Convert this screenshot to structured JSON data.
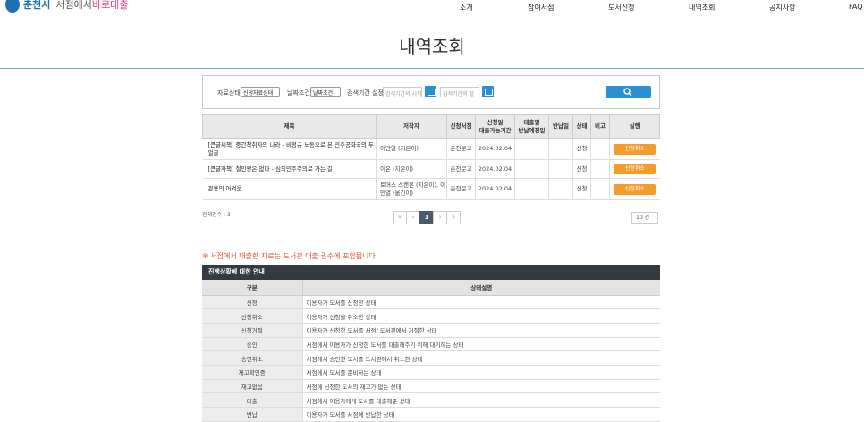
{
  "header": {
    "city": "춘천시",
    "service_prefix": "서점에서",
    "service_accent": "바로대출",
    "nav": [
      "소개",
      "참여서점",
      "도서신청",
      "내역조회",
      "공지사항",
      "FAQ"
    ]
  },
  "page_title": "내역조회",
  "search": {
    "material_status_label": "자료상태",
    "material_status_value": "신청자료상태",
    "date_condition_label": "날짜조건",
    "date_condition_value": "날짜조건",
    "period_label": "검색기간 설정",
    "start_placeholder": "검색기간의 시작",
    "end_placeholder": "검색기간의 끝"
  },
  "table": {
    "headers": [
      "제목",
      "저작자",
      "신청서점",
      "신청일\n대출가능기간",
      "대출일\n반납예정일",
      "반납일",
      "상태",
      "비고",
      "실행"
    ],
    "rows": [
      {
        "title": "[큰글씨책] 중간착취자의 나라 - 비정규 노동으로 본 민주공화국의 두 얼굴",
        "author": "이만열 (지은이)",
        "store": "춘천문고",
        "date": "2024.02.04",
        "status": "신청",
        "action": "신청취소"
      },
      {
        "title": "[큰글자책] 철인왕은 없다 - 심의민주주의로 가는 길",
        "author": "이은 (지은이)",
        "store": "춘천문고",
        "date": "2024.02.04",
        "status": "신청",
        "action": "신청취소"
      },
      {
        "title": "관용의 어려움",
        "author": "토머스 스캔론 (지은이), 이민열 (옮긴이)",
        "store": "춘천문고",
        "date": "2024.02.04",
        "status": "신청",
        "action": "신청취소"
      }
    ]
  },
  "total": "전체건수 : 3",
  "pager": {
    "first": "«",
    "prev": "‹",
    "current": "1",
    "next": "›",
    "last": "»"
  },
  "page_size": "10 건",
  "notice": "※ 서점에서 대출한 자료는 도서관 대출 권수에 포함됩니다",
  "guide": {
    "title": "진행상황에 대한 안내",
    "col_key": "구분",
    "col_value": "상태설명",
    "rows": [
      {
        "k": "신청",
        "v": "이용자가 도서를 신청한 상태"
      },
      {
        "k": "신청취소",
        "v": "이용자가 신청을 취소한 상태"
      },
      {
        "k": "신청거절",
        "v": "이용자가 신청한 도서를 서점/ 도서관에서 거절한 상태"
      },
      {
        "k": "승인",
        "v": "서점에서 이용자가 신청한 도서를 대출해주기 위해 대기하는 상태"
      },
      {
        "k": "승인취소",
        "v": "서점에서 승인한 도서를 도서관에서 취소한 상태"
      },
      {
        "k": "재고확인중",
        "v": "서점에서 도서를 준비하는 상태"
      },
      {
        "k": "재고없음",
        "v": "서점에 신청한 도서의 재고가 없는 상태"
      },
      {
        "k": "대출",
        "v": "서점에서 이용자에게 도서를 대출해준 상태"
      },
      {
        "k": "반납",
        "v": "이용자가 도서를 서점에 반납한 상태"
      }
    ]
  },
  "colors": {
    "primary": "#2b8fd6",
    "cancel": "#f39c2b",
    "notice": "#e0502a",
    "guide_head": "#333a42"
  }
}
